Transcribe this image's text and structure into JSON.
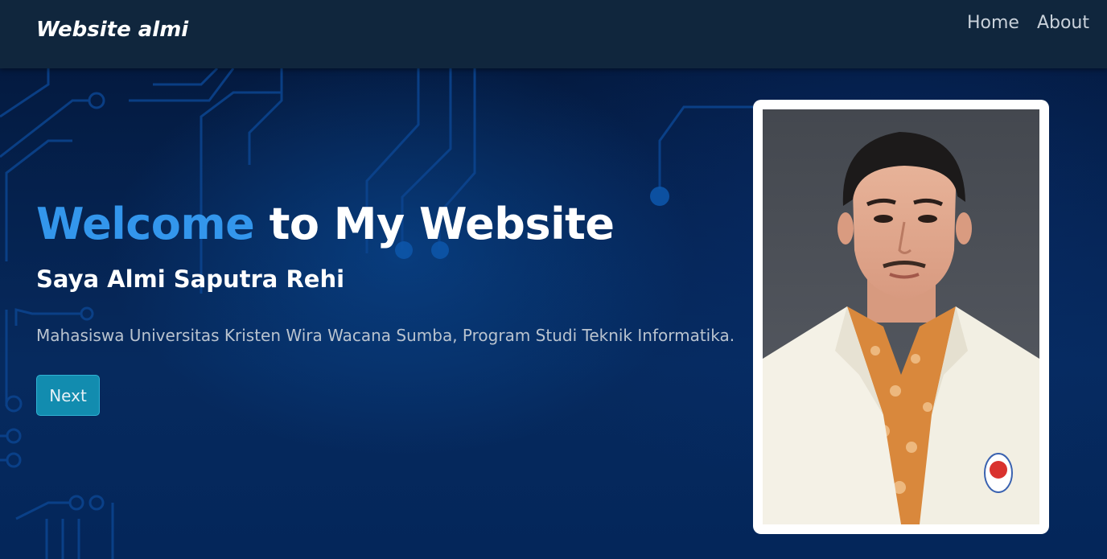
{
  "navbar": {
    "brand": "Website almi",
    "links": [
      {
        "label": "Home"
      },
      {
        "label": "About"
      }
    ]
  },
  "hero": {
    "title_accent": "Welcome",
    "title_rest": " to My Website",
    "subtitle": "Saya Almi Saputra Rehi",
    "description": "Mahasiswa Universitas Kristen Wira Wacana Sumba, Program Studi Teknik Informatika.",
    "button_label": "Next",
    "photo_alt": "Foto Almi Saputra Rehi"
  },
  "colors": {
    "navbar_bg": "#10263d",
    "hero_bg": "#05234f",
    "accent": "#3396ec",
    "button_bg": "#128caf",
    "circuit": "#0d4c9a"
  }
}
